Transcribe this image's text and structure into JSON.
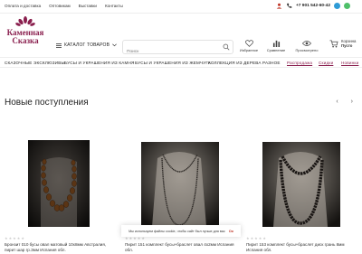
{
  "topnav": [
    "Оплата и доставка",
    "Оптовикам",
    "Выставки",
    "Контакты"
  ],
  "phone": "+7 901 542-60-42",
  "brand": {
    "line1": "Каменная",
    "line2": "Сказка",
    "color": "#8a1f4e"
  },
  "header": {
    "catalog_label": "КАТАЛОГ ТОВАРОВ",
    "search_placeholder": "Поиск",
    "favorites_label": "Избранное",
    "compare_label": "Сравнение",
    "viewed_label": "Просмотрено",
    "cart_label": "Корзина",
    "cart_value": "Пусто",
    "badge_zero": "0"
  },
  "catnav": [
    {
      "label": "СКАЗОЧНЫЕ ЭКСКЛЮЗИВЫ",
      "highlight": false
    },
    {
      "label": "БУСЫ И УКРАШЕНИЯ ИЗ КАМНЯ",
      "highlight": false
    },
    {
      "label": "БУСЫ И УКРАШЕНИЯ ИЗ ЖЕМЧУГА",
      "highlight": false
    },
    {
      "label": "КОЛЛЕКЦИЯ ИЗ ДЕРЕВА",
      "highlight": false
    },
    {
      "label": "РАЗНОЕ",
      "highlight": false
    },
    {
      "label": "Распродажа",
      "highlight": true
    },
    {
      "label": "Скидки",
      "highlight": true
    },
    {
      "label": "Новинки",
      "highlight": true
    }
  ],
  "section": {
    "title": "Новые поступления",
    "prev": "‹",
    "next": "›"
  },
  "products": [
    {
      "title": "Бронзит 010 бусы овал матовый 10х8мм Австралия, пирит шар гр.3мм Испания обл.",
      "stars": "★★★★★"
    },
    {
      "title": "Пирит 151 комплект бусы+браслет овал 4х2мм Испания обл.",
      "stars": "★★★★★"
    },
    {
      "title": "Пирит 153 комплект бусы+браслет диск грань 8мм Испания обл.",
      "stars": "★★★★★"
    }
  ],
  "cookie": {
    "text": "Мы используем файлы cookie, чтобы сайт был лучше для вас",
    "ok": "Ок"
  }
}
